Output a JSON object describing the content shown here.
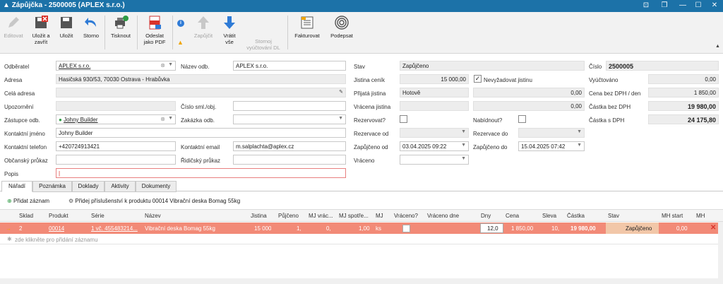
{
  "window": {
    "title": "Zápůjčka - 2500005  (APLEX s.r.o.)"
  },
  "ribbon": {
    "edit": "Editovat",
    "save_close": [
      "Uložit a",
      "zavřít"
    ],
    "save": "Uložit",
    "storno": "Storno",
    "print": "Tisknout",
    "send_pdf": [
      "Odeslat",
      "jako PDF"
    ],
    "lend": "Zapůjčit",
    "return_all": [
      "Vrátit",
      "vše"
    ],
    "cancel_dl": [
      "Stornoj",
      "vyúčtování DL"
    ],
    "invoice": "Fakturovat",
    "sign": "Podepsat"
  },
  "form": {
    "odberatel_label": "Odběratel",
    "odberatel": "APLEX s.r.o.",
    "nazev_odb_label": "Název odb.",
    "nazev_odb": "APLEX s.r.o.",
    "adresa_label": "Adresa",
    "adresa": "Hasičská 930/53, 70030 Ostrava - Hrabůvka",
    "cela_adresa_label": "Celá adresa",
    "upozorneni_label": "Upozornění",
    "cislo_sml_label": "Číslo sml./obj.",
    "zastupce_label": "Zástupce odb.",
    "zastupce": "Johny Builder",
    "zakazka_label": "Zakázka odb.",
    "kontaktni_jmeno_label": "Kontaktní jméno",
    "kontaktni_jmeno": "Johny Builder",
    "telefon_label": "Kontaktní telefon",
    "telefon": "+420724913421",
    "email_label": "Kontaktní email",
    "email": "m.salplachta@aplex.cz",
    "obcansky_label": "Občanský průkaz",
    "ridicsky_label": "Řidičský průkaz",
    "popis_label": "Popis",
    "stav_label": "Stav",
    "stav": "Zapůjčeno",
    "jistina_cenik_label": "Jistina ceník",
    "jistina_cenik": "15 000,00",
    "nevyzadovat_label": "Nevyžadovat jistinu",
    "prijata_jistina_label": "Přijatá jistina",
    "prijata_jistina": "Hotově",
    "prijata_jistina_val": "0,00",
    "vracena_jistina_label": "Vrácena jistina",
    "vracena_jistina_val": "0,00",
    "rezervovat_label": "Rezervovat?",
    "nabidnout_label": "Nabídnout?",
    "rezervace_od_label": "Rezervace od",
    "rezervace_do_label": "Rezervace do",
    "zapujceno_od_label": "Zapůjčeno od",
    "zapujceno_od": "03.04.2025 09:22",
    "zapujceno_do_label": "Zapůjčeno do",
    "zapujceno_do": "15.04.2025 07:42",
    "vraceno_label": "Vráceno",
    "cislo_label": "Číslo",
    "cislo": "2500005",
    "vyuctovano_label": "Vyúčtováno",
    "vyuctovano": "0,00",
    "cena_den_label": "Cena bez DPH / den",
    "cena_den": "1 850,00",
    "castka_bez_label": "Částka bez DPH",
    "castka_bez": "19 980,00",
    "castka_s_label": "Částka s DPH",
    "castka_s": "24 175,80"
  },
  "tabs": [
    "Nářadí",
    "Poznámka",
    "Doklady",
    "Aktivity",
    "Dokumenty"
  ],
  "grid": {
    "add_record": "Přidat záznam",
    "add_accessory": "Přidej příslušenství k produktu 00014 Vibrační deska Bomag 55kg",
    "headers": [
      "Sklad",
      "Produkt",
      "Série",
      "Název",
      "Jistina",
      "Půjčeno",
      "MJ vrác...",
      "MJ spotře...",
      "MJ",
      "Vráceno?",
      "Vráceno dne",
      "Dny",
      "Cena",
      "Sleva",
      "Částka",
      "Stav",
      "MH start",
      "MH"
    ],
    "row": {
      "sklad": "2",
      "produkt": "00014",
      "serie": "1 vč. 455483214...",
      "nazev": "Vibrační deska Bomag 55kg",
      "jistina": "15 000",
      "pujceno": "1,",
      "mj_vrac": "0,",
      "mj_spot": "1,00",
      "mj": "ks",
      "dny": "12,0",
      "cena": "1 850,00",
      "sleva": "10,",
      "castka": "19 980,00",
      "stav": "Zapůjčeno",
      "mh_start": "0,00"
    },
    "new_row": "zde klikněte pro přidání záznamu"
  },
  "colors": {
    "titlebar": "#1c72a8",
    "row_highlight": "#f28a77",
    "stav_cell": "#f2c7a8"
  }
}
